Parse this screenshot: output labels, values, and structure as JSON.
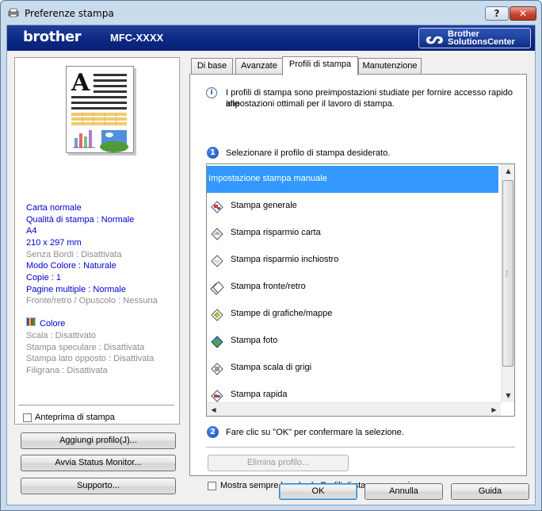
{
  "window": {
    "title": "Preferenze stampa",
    "help_label": "?",
    "close_label": "✕"
  },
  "banner": {
    "brand": "brother",
    "model": "MFC-XXXX",
    "solutions_line1": "Brother",
    "solutions_line2": "SolutionsCenter"
  },
  "summary": {
    "lines": [
      {
        "text": "Carta normale",
        "style": "blue"
      },
      {
        "text": "Qualità di stampa : Normale",
        "style": "blue"
      },
      {
        "text": "A4",
        "style": "blue"
      },
      {
        "text": "210 x 297 mm",
        "style": "blue"
      },
      {
        "text": "Senza Bordi : Disattivata",
        "style": "gray"
      },
      {
        "text": "Modo Colore : Naturale",
        "style": "blue"
      },
      {
        "text": "Copie : 1",
        "style": "blue"
      },
      {
        "text": "Pagine multiple : Normale",
        "style": "blue"
      },
      {
        "text": "Fronte/retro / Opuscolo : Nessuna",
        "style": "gray"
      }
    ],
    "colore_label": "Colore",
    "lines2": [
      {
        "text": "Scala : Disattivato",
        "style": "gray"
      },
      {
        "text": "Stampa speculare : Disattivata",
        "style": "gray"
      },
      {
        "text": "Stampa lato opposto : Disattivata",
        "style": "gray"
      },
      {
        "text": "Filigrana : Disattivata",
        "style": "gray"
      }
    ]
  },
  "left_controls": {
    "preview_checkbox": "Anteprima di stampa",
    "add_profile": "Aggiungi profilo(J)...",
    "status_monitor": "Avvia Status Monitor...",
    "support": "Supporto..."
  },
  "tabs": [
    "Di base",
    "Avanzate",
    "Profili di stampa",
    "Manutenzione"
  ],
  "active_tab": "Profili di stampa",
  "profiles_page": {
    "intro": [
      "I profili di stampa sono preimpostazioni studiate per fornire accesso rapido alle",
      "impostazioni ottimali per il lavoro di stampa."
    ],
    "step1_number": "1",
    "step1": "Selezionare il profilo di stampa desiderato.",
    "items": [
      {
        "label": "Impostazione stampa manuale",
        "icon": "none",
        "selected": true
      },
      {
        "label": "Stampa generale",
        "icon": "general-print-icon"
      },
      {
        "label": "Stampa risparmio carta",
        "icon": "paper-save-icon"
      },
      {
        "label": "Stampa risparmio inchiostro",
        "icon": "ink-save-icon"
      },
      {
        "label": "Stampa fronte/retro",
        "icon": "duplex-icon"
      },
      {
        "label": "Stampe di grafiche/mappe",
        "icon": "graphics-map-icon"
      },
      {
        "label": "Stampa foto",
        "icon": "photo-print-icon"
      },
      {
        "label": "Stampa scala di grigi",
        "icon": "grayscale-icon"
      },
      {
        "label": "Stampa rapida",
        "icon": "quick-print-icon"
      }
    ],
    "step2_number": "2",
    "step2": "Fare clic su \"OK\" per confermare la selezione.",
    "delete_profile": "Elimina profilo...",
    "always_show": "Mostra sempre la scheda Profili di stampa per prima."
  },
  "footer": {
    "ok": "OK",
    "cancel": "Annulla",
    "help": "Guida"
  },
  "colors": {
    "banner": "#0a2781",
    "selection": "#3399ff",
    "link_blue": "#0000cc"
  }
}
